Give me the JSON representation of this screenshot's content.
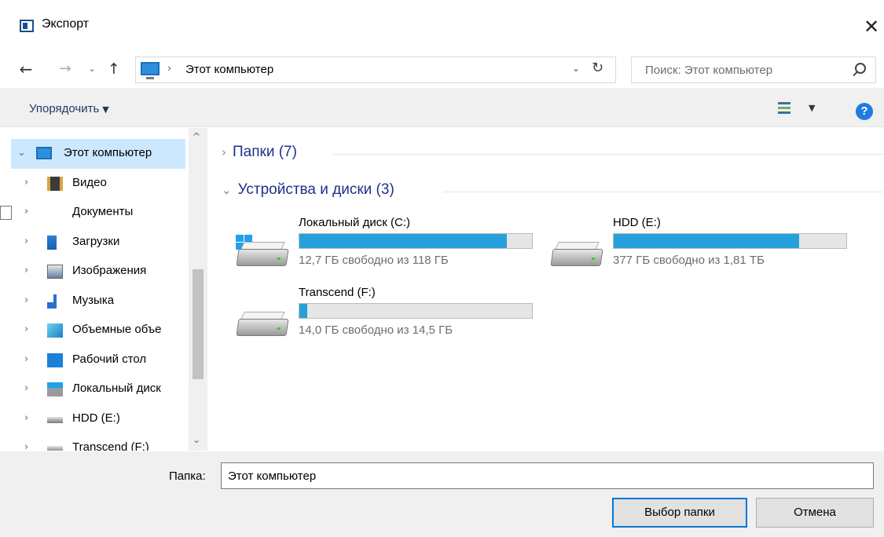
{
  "window": {
    "title": "Экспорт",
    "close_glyph": "✕"
  },
  "navigation": {
    "back_glyph": "←",
    "forward_glyph": "→",
    "recent_glyph": "⌄",
    "up_glyph": "↑",
    "address": "Этот компьютер",
    "address_separator": "›",
    "address_dropdown_glyph": "⌄",
    "refresh_glyph": "↻",
    "search_placeholder": "Поиск: Этот компьютер"
  },
  "toolbar": {
    "organize_label": "Упорядочить",
    "organize_arrow": "▼",
    "view_arrow": "▼",
    "help_label": "?"
  },
  "sidebar": {
    "items": [
      {
        "label": "Этот компьютер",
        "icon": "computer-icon",
        "chevron": "⌄",
        "selected": true
      },
      {
        "label": "Видео",
        "icon": "video-icon",
        "chevron": "›"
      },
      {
        "label": "Документы",
        "icon": "documents-icon",
        "chevron": "›"
      },
      {
        "label": "Загрузки",
        "icon": "downloads-icon",
        "chevron": "›"
      },
      {
        "label": "Изображения",
        "icon": "pictures-icon",
        "chevron": "›"
      },
      {
        "label": "Музыка",
        "icon": "music-icon",
        "chevron": "›"
      },
      {
        "label": "Объемные объе",
        "icon": "3d-objects-icon",
        "chevron": "›"
      },
      {
        "label": "Рабочий стол",
        "icon": "desktop-icon",
        "chevron": "›"
      },
      {
        "label": "Локальный диск",
        "icon": "local-disk-icon",
        "chevron": "›"
      },
      {
        "label": "HDD (E:)",
        "icon": "drive-icon",
        "chevron": "›"
      },
      {
        "label": "Transcend (F:)",
        "icon": "drive-icon",
        "chevron": "›"
      }
    ],
    "scroll_up_glyph": "^",
    "scroll_down_glyph": "⌄"
  },
  "content": {
    "groups": [
      {
        "label": "Папки (7)",
        "chevron": "›"
      },
      {
        "label": "Устройства и диски (3)",
        "chevron": "⌄"
      }
    ],
    "drives": [
      {
        "name": "Локальный диск (C:)",
        "free_text": "12,7 ГБ свободно из 118 ГБ",
        "used_fraction": 0.892,
        "icon": "windows-drive-icon"
      },
      {
        "name": "HDD (E:)",
        "free_text": "377 ГБ свободно из 1,81 ТБ",
        "used_fraction": 0.797,
        "icon": "drive-icon"
      },
      {
        "name": "Transcend (F:)",
        "free_text": "14,0 ГБ свободно из 14,5 ГБ",
        "used_fraction": 0.034,
        "icon": "drive-icon"
      }
    ],
    "bar_color": "#26a0da"
  },
  "footer": {
    "folder_label": "Папка:",
    "folder_value": "Этот компьютер",
    "select_button": "Выбор папки",
    "cancel_button": "Отмена"
  }
}
